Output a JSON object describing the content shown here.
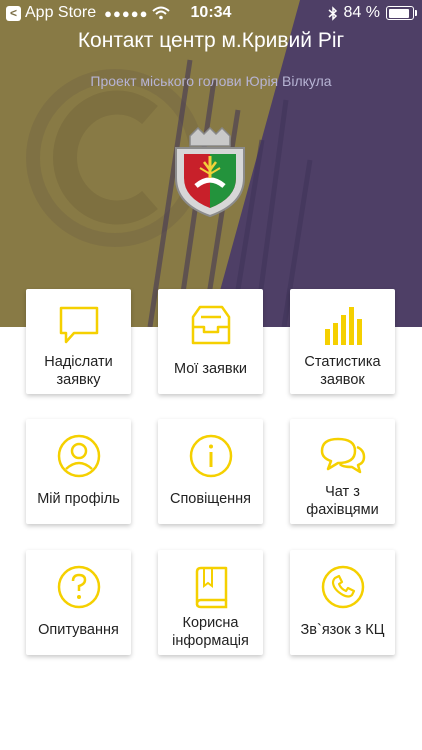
{
  "status_bar": {
    "back_app": "App Store",
    "signal": "●●●●●",
    "time": "10:34",
    "battery": "84 %",
    "battery_level": 0.84
  },
  "header": {
    "title": "Контакт центр м.Кривий Ріг",
    "subtitle": "Проект міського голови Юрія Вілкула"
  },
  "colors": {
    "accent": "#f5d000",
    "olive": "#887a45",
    "purple": "#4e3f66"
  },
  "tiles": [
    {
      "label_1": "Надіслати",
      "label_2": "заявку",
      "icon": "message-icon"
    },
    {
      "label_1": "Мої заявки",
      "label_2": "",
      "icon": "inbox-tray-icon"
    },
    {
      "label_1": "Статистика",
      "label_2": "заявок",
      "icon": "bar-chart-icon"
    },
    {
      "label_1": "Мій профіль",
      "label_2": "",
      "icon": "user-profile-icon"
    },
    {
      "label_1": "Сповіщення",
      "label_2": "",
      "icon": "info-icon"
    },
    {
      "label_1": "Чат з",
      "label_2": "фахівцями",
      "icon": "chat-icon"
    },
    {
      "label_1": "Опитування",
      "label_2": "",
      "icon": "question-icon"
    },
    {
      "label_1": "Корисна",
      "label_2": "інформація",
      "icon": "book-icon"
    },
    {
      "label_1": "Зв`язок з КЦ",
      "label_2": "",
      "icon": "phone-icon"
    }
  ]
}
